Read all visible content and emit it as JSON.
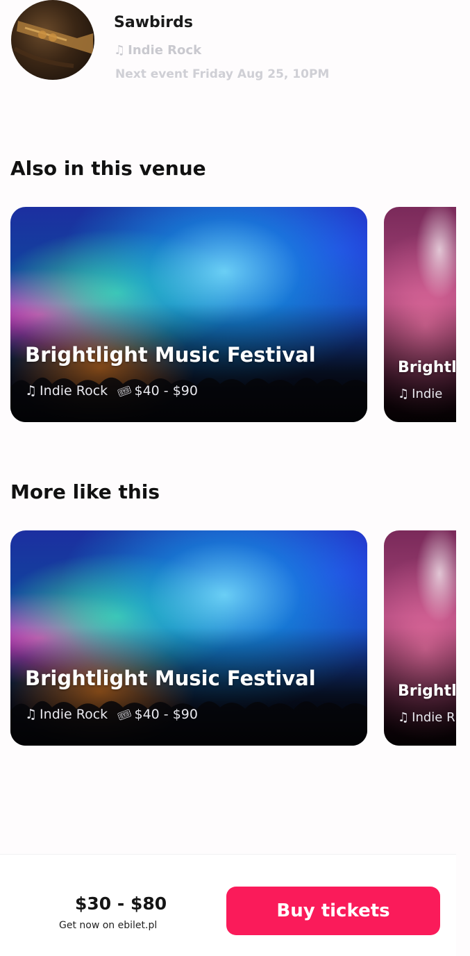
{
  "artist": {
    "name": "Sawbirds",
    "genre": "Indie Rock",
    "next_event": "Next event Friday Aug 25, 10PM",
    "note_icon": "music-note-icon"
  },
  "sections": {
    "venue_title": "Also in this venue",
    "more_title": "More like this"
  },
  "venue_cards": [
    {
      "title": "Brightlight Music Festival",
      "genre": "Indie Rock",
      "price": "$40 - $90"
    },
    {
      "title": "Brightl",
      "genre": "Indie"
    }
  ],
  "more_cards": [
    {
      "title": "Brightlight Music Festival",
      "genre": "Indie Rock",
      "price": "$40 - $90"
    },
    {
      "title": "Brightli",
      "genre": "Indie R"
    }
  ],
  "bottom_bar": {
    "price_range": "$30 - $80",
    "source": "Get now on ebilet.pl",
    "buy_label": "Buy tickets",
    "accent_color": "#fa1b5a"
  }
}
